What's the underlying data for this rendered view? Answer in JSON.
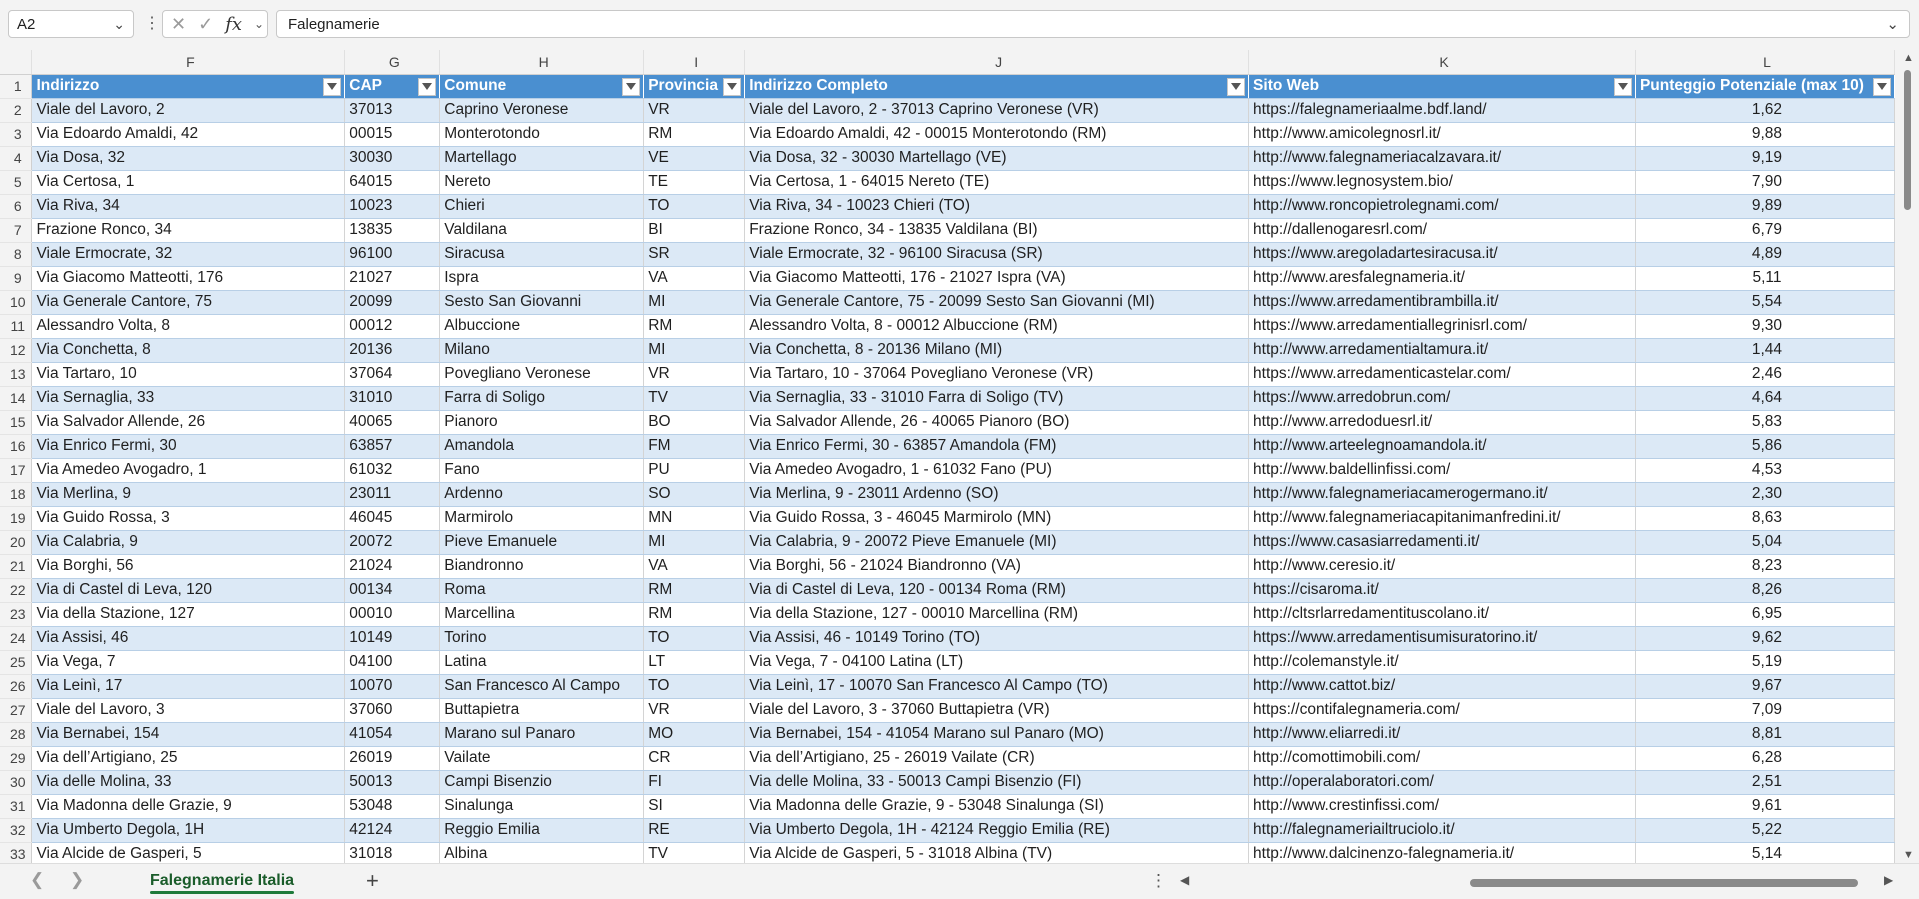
{
  "formula_bar": {
    "name_box": "A2",
    "fx_label": "fx",
    "value": "Falegnamerie"
  },
  "columns": {
    "letters": [
      "F",
      "G",
      "H",
      "I",
      "J",
      "K",
      "L"
    ],
    "headers": [
      "Indirizzo",
      "CAP",
      "Comune",
      "Provincia",
      "Indirizzo Completo",
      "Sito Web",
      "Punteggio Potenziale (max 10)"
    ]
  },
  "header_row_number": "1",
  "rows": [
    {
      "n": "2",
      "c": [
        "Viale del Lavoro, 2",
        "37013",
        "Caprino Veronese",
        "VR",
        "Viale del Lavoro, 2 - 37013 Caprino Veronese (VR)",
        "https://falegnameriaalme.bdf.land/",
        "1,62"
      ]
    },
    {
      "n": "3",
      "c": [
        "Via Edoardo Amaldi, 42",
        "00015",
        "Monterotondo",
        "RM",
        "Via Edoardo Amaldi, 42 - 00015 Monterotondo (RM)",
        "http://www.amicolegnosrl.it/",
        "9,88"
      ]
    },
    {
      "n": "4",
      "c": [
        "Via Dosa, 32",
        "30030",
        "Martellago",
        "VE",
        "Via Dosa, 32 - 30030 Martellago (VE)",
        "http://www.falegnameriacalzavara.it/",
        "9,19"
      ]
    },
    {
      "n": "5",
      "c": [
        "Via Certosa, 1",
        "64015",
        "Nereto",
        "TE",
        "Via Certosa, 1 - 64015 Nereto (TE)",
        "https://www.legnosystem.bio/",
        "7,90"
      ]
    },
    {
      "n": "6",
      "c": [
        "Via Riva, 34",
        "10023",
        "Chieri",
        "TO",
        "Via Riva, 34 - 10023 Chieri (TO)",
        "http://www.roncopietrolegnami.com/",
        "9,89"
      ]
    },
    {
      "n": "7",
      "c": [
        "Frazione Ronco, 34",
        "13835",
        "Valdilana",
        "BI",
        "Frazione Ronco, 34 - 13835 Valdilana (BI)",
        "http://dallenogaresrl.com/",
        "6,79"
      ]
    },
    {
      "n": "8",
      "c": [
        "Viale Ermocrate, 32",
        "96100",
        "Siracusa",
        "SR",
        "Viale Ermocrate, 32 - 96100 Siracusa (SR)",
        "https://www.aregoladartesiracusa.it/",
        "4,89"
      ]
    },
    {
      "n": "9",
      "c": [
        "Via Giacomo Matteotti, 176",
        "21027",
        "Ispra",
        "VA",
        "Via Giacomo Matteotti, 176 - 21027 Ispra (VA)",
        "http://www.aresfalegnameria.it/",
        "5,11"
      ]
    },
    {
      "n": "10",
      "c": [
        "Via Generale Cantore, 75",
        "20099",
        "Sesto San Giovanni",
        "MI",
        "Via Generale Cantore, 75 - 20099 Sesto San Giovanni (MI)",
        "https://www.arredamentibrambilla.it/",
        "5,54"
      ]
    },
    {
      "n": "11",
      "c": [
        "Alessandro Volta, 8",
        "00012",
        "Albuccione",
        "RM",
        "Alessandro Volta, 8 - 00012 Albuccione (RM)",
        "https://www.arredamentiallegrinisrl.com/",
        "9,30"
      ]
    },
    {
      "n": "12",
      "c": [
        "Via Conchetta, 8",
        "20136",
        "Milano",
        "MI",
        "Via Conchetta, 8 - 20136 Milano (MI)",
        "http://www.arredamentialtamura.it/",
        "1,44"
      ]
    },
    {
      "n": "13",
      "c": [
        "Via Tartaro, 10",
        "37064",
        "Povegliano Veronese",
        "VR",
        "Via Tartaro, 10 - 37064 Povegliano Veronese (VR)",
        "https://www.arredamenticastelar.com/",
        "2,46"
      ]
    },
    {
      "n": "14",
      "c": [
        "Via Sernaglia, 33",
        "31010",
        "Farra di Soligo",
        "TV",
        "Via Sernaglia, 33 - 31010 Farra di Soligo (TV)",
        "https://www.arredobrun.com/",
        "4,64"
      ]
    },
    {
      "n": "15",
      "c": [
        "Via Salvador Allende, 26",
        "40065",
        "Pianoro",
        "BO",
        "Via Salvador Allende, 26 - 40065 Pianoro (BO)",
        "http://www.arredoduesrl.it/",
        "5,83"
      ]
    },
    {
      "n": "16",
      "c": [
        "Via Enrico Fermi, 30",
        "63857",
        "Amandola",
        "FM",
        "Via Enrico Fermi, 30 - 63857 Amandola (FM)",
        "http://www.arteelegnoamandola.it/",
        "5,86"
      ]
    },
    {
      "n": "17",
      "c": [
        "Via Amedeo Avogadro, 1",
        "61032",
        "Fano",
        "PU",
        "Via Amedeo Avogadro, 1 - 61032 Fano (PU)",
        "http://www.baldellinfissi.com/",
        "4,53"
      ]
    },
    {
      "n": "18",
      "c": [
        "Via Merlina, 9",
        "23011",
        "Ardenno",
        "SO",
        "Via Merlina, 9 - 23011 Ardenno (SO)",
        "http://www.falegnameriacamerogermano.it/",
        "2,30"
      ]
    },
    {
      "n": "19",
      "c": [
        "Via Guido Rossa, 3",
        "46045",
        "Marmirolo",
        "MN",
        "Via Guido Rossa, 3 - 46045 Marmirolo (MN)",
        "http://www.falegnameriacapitanimanfredini.it/",
        "8,63"
      ]
    },
    {
      "n": "20",
      "c": [
        "Via Calabria, 9",
        "20072",
        "Pieve Emanuele",
        "MI",
        "Via Calabria, 9 - 20072 Pieve Emanuele (MI)",
        "https://www.casasiarredamenti.it/",
        "5,04"
      ]
    },
    {
      "n": "21",
      "c": [
        "Via Borghi, 56",
        "21024",
        "Biandronno",
        "VA",
        "Via Borghi, 56 - 21024 Biandronno (VA)",
        "http://www.ceresio.it/",
        "8,23"
      ]
    },
    {
      "n": "22",
      "c": [
        "Via di Castel di Leva, 120",
        "00134",
        "Roma",
        "RM",
        "Via di Castel di Leva, 120 - 00134 Roma (RM)",
        "https://cisaroma.it/",
        "8,26"
      ]
    },
    {
      "n": "23",
      "c": [
        "Via della Stazione, 127",
        "00010",
        "Marcellina",
        "RM",
        "Via della Stazione, 127 - 00010 Marcellina (RM)",
        "http://cltsrlarredamentituscolano.it/",
        "6,95"
      ]
    },
    {
      "n": "24",
      "c": [
        "Via Assisi, 46",
        "10149",
        "Torino",
        "TO",
        "Via Assisi, 46 - 10149 Torino (TO)",
        "https://www.arredamentisumisuratorino.it/",
        "9,62"
      ]
    },
    {
      "n": "25",
      "c": [
        "Via Vega, 7",
        "04100",
        "Latina",
        "LT",
        "Via Vega, 7 - 04100 Latina (LT)",
        "http://colemanstyle.it/",
        "5,19"
      ]
    },
    {
      "n": "26",
      "c": [
        "Via Leinì, 17",
        "10070",
        "San Francesco Al Campo",
        "TO",
        "Via Leinì, 17 - 10070 San Francesco Al Campo (TO)",
        "http://www.cattot.biz/",
        "9,67"
      ]
    },
    {
      "n": "27",
      "c": [
        "Viale del Lavoro, 3",
        "37060",
        "Buttapietra",
        "VR",
        "Viale del Lavoro, 3 - 37060 Buttapietra (VR)",
        "https://contifalegnameria.com/",
        "7,09"
      ]
    },
    {
      "n": "28",
      "c": [
        "Via Bernabei, 154",
        "41054",
        "Marano sul Panaro",
        "MO",
        "Via Bernabei, 154 - 41054 Marano sul Panaro (MO)",
        "http://www.eliarredi.it/",
        "8,81"
      ]
    },
    {
      "n": "29",
      "c": [
        "Via dell’Artigiano, 25",
        "26019",
        "Vailate",
        "CR",
        "Via dell’Artigiano, 25 - 26019 Vailate (CR)",
        "http://comottimobili.com/",
        "6,28"
      ]
    },
    {
      "n": "30",
      "c": [
        "Via delle Molina, 33",
        "50013",
        "Campi Bisenzio",
        "FI",
        "Via delle Molina, 33 - 50013 Campi Bisenzio (FI)",
        "http://operalaboratori.com/",
        "2,51"
      ]
    },
    {
      "n": "31",
      "c": [
        "Via Madonna delle Grazie, 9",
        "53048",
        "Sinalunga",
        "SI",
        "Via Madonna delle Grazie, 9 - 53048 Sinalunga (SI)",
        "http://www.crestinfissi.com/",
        "9,61"
      ]
    },
    {
      "n": "32",
      "c": [
        "Via Umberto Degola, 1H",
        "42124",
        "Reggio Emilia",
        "RE",
        "Via Umberto Degola, 1H - 42124 Reggio Emilia (RE)",
        "http://falegnameriailtruciolo.it/",
        "5,22"
      ]
    },
    {
      "n": "33",
      "c": [
        "Via Alcide de Gasperi, 5",
        "31018",
        "Albina",
        "TV",
        "Via Alcide de Gasperi, 5 - 31018 Albina (TV)",
        "http://www.dalcinenzo-falegnameria.it/",
        "5,14"
      ]
    }
  ],
  "sheet_bar": {
    "active_tab": "Falegnamerie Italia",
    "add_icon": "+"
  },
  "colors": {
    "header_fill": "#4a8fd0",
    "band_fill": "#dce9f6",
    "tab_accent": "#1e7a3b"
  }
}
